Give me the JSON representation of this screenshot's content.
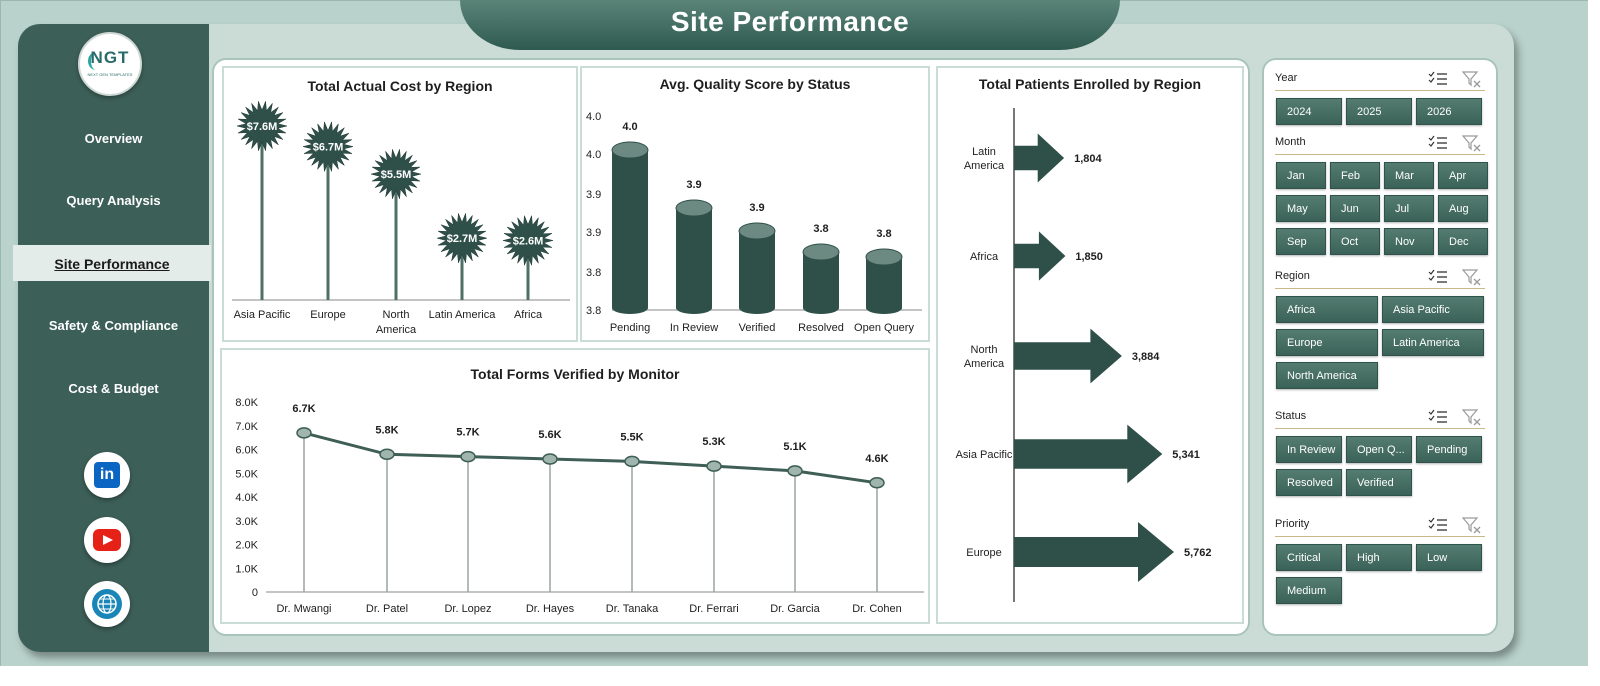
{
  "page_title": "Site Performance",
  "logo": {
    "text": "NGT",
    "subtext": "NEXT GEN TEMPLATES"
  },
  "sidebar": {
    "items": [
      {
        "label": "Overview"
      },
      {
        "label": "Query Analysis"
      },
      {
        "label": "Site Performance"
      },
      {
        "label": "Safety & Compliance"
      },
      {
        "label": "Cost & Budget"
      }
    ],
    "active": "Site Performance",
    "social": [
      "linkedin-icon",
      "youtube-icon",
      "globe-icon"
    ]
  },
  "colors": {
    "dark_green": "#3c5f57",
    "panel_bg": "#b9d2cb",
    "accent_dark": "#2f5048"
  },
  "charts": {
    "cost_by_region": {
      "title": "Total Actual Cost by Region",
      "chart_data": {
        "type": "lollipop",
        "categories": [
          "Asia Pacific",
          "Europe",
          "North America",
          "Latin America",
          "Africa"
        ],
        "values": [
          7.6,
          6.7,
          5.5,
          2.7,
          2.6
        ],
        "labels": [
          "$7.6M",
          "$6.7M",
          "$5.5M",
          "$2.7M",
          "$2.6M"
        ]
      }
    },
    "quality_by_status": {
      "title": "Avg. Quality Score by Status",
      "chart_data": {
        "type": "bar",
        "categories": [
          "Pending",
          "In Review",
          "Verified",
          "Resolved",
          "Open Query"
        ],
        "values": [
          4.0,
          3.9,
          3.9,
          3.8,
          3.8
        ],
        "labels": [
          "4.0",
          "3.9",
          "3.9",
          "3.8",
          "3.8"
        ],
        "ytick_labels": [
          "4.0",
          "4.0",
          "3.9",
          "3.9",
          "3.8",
          "3.8"
        ]
      }
    },
    "patients_by_region": {
      "title": "Total Patients Enrolled by Region",
      "chart_data": {
        "type": "bar",
        "categories": [
          "Latin America",
          "Africa",
          "North America",
          "Asia Pacific",
          "Europe"
        ],
        "values": [
          1804,
          1850,
          3884,
          5341,
          5762
        ],
        "labels": [
          "1,804",
          "1,850",
          "3,884",
          "5,341",
          "5,762"
        ]
      }
    },
    "forms_by_monitor": {
      "title": "Total Forms Verified by Monitor",
      "chart_data": {
        "type": "line",
        "categories": [
          "Dr. Mwangi",
          "Dr. Patel",
          "Dr. Lopez",
          "Dr. Hayes",
          "Dr. Tanaka",
          "Dr. Ferrari",
          "Dr. Garcia",
          "Dr. Cohen"
        ],
        "values": [
          6.7,
          5.8,
          5.7,
          5.6,
          5.5,
          5.3,
          5.1,
          4.6
        ],
        "labels": [
          "6.7K",
          "5.8K",
          "5.7K",
          "5.6K",
          "5.5K",
          "5.3K",
          "5.1K",
          "4.6K"
        ],
        "ytick_labels": [
          "0",
          "1.0K",
          "2.0K",
          "3.0K",
          "4.0K",
          "5.0K",
          "6.0K",
          "7.0K",
          "8.0K"
        ],
        "ylim": [
          0,
          8
        ]
      }
    }
  },
  "slicers": {
    "year": {
      "label": "Year",
      "options": [
        "2024",
        "2025",
        "2026"
      ]
    },
    "month": {
      "label": "Month",
      "options": [
        "Jan",
        "Feb",
        "Mar",
        "Apr",
        "May",
        "Jun",
        "Jul",
        "Aug",
        "Sep",
        "Oct",
        "Nov",
        "Dec"
      ]
    },
    "region": {
      "label": "Region",
      "options": [
        "Africa",
        "Asia Pacific",
        "Europe",
        "Latin America",
        "North America"
      ]
    },
    "status": {
      "label": "Status",
      "options": [
        "In Review",
        "Open Q...",
        "Pending",
        "Resolved",
        "Verified"
      ]
    },
    "priority": {
      "label": "Priority",
      "options": [
        "Critical",
        "High",
        "Low",
        "Medium"
      ]
    }
  }
}
